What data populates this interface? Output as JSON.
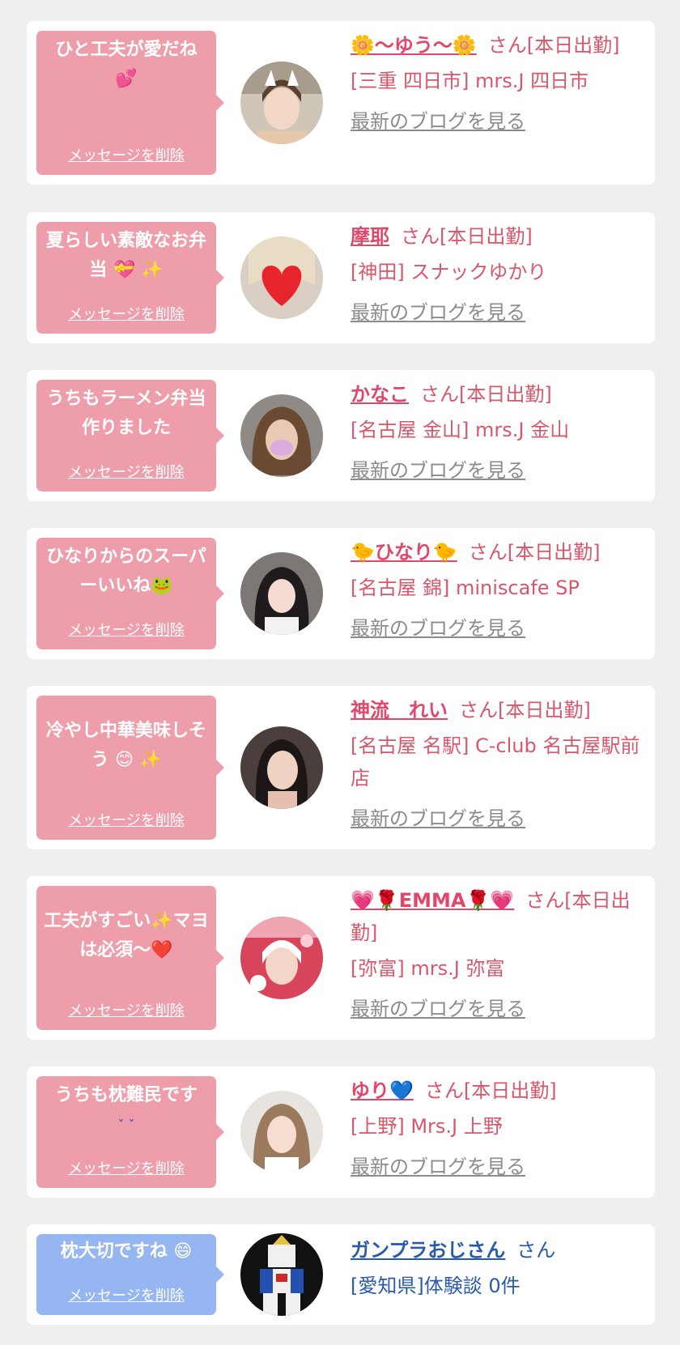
{
  "colors": {
    "bubble_pink": "#ee9eab",
    "bubble_blue": "#95b6f0",
    "name_pink": "#e0486a",
    "text_pink": "#d9576b",
    "text_blue": "#2b5aa8",
    "link_gray": "#8c8c8c",
    "background": "#efefef"
  },
  "delete_label": "メッセージを削除",
  "blog_label": "最新のブログを見る",
  "items": [
    {
      "message": "ひと工夫が愛だね",
      "message_emoji": "💕",
      "name": "🌼〜ゆう〜🌼",
      "suffix": "さん[本日出勤]",
      "shop": "[三重 四日市] mrs.J 四日市"
    },
    {
      "message": "夏らしい素敵なお弁当",
      "message_emoji": "💝 ✨",
      "name": "摩耶",
      "suffix": "さん[本日出勤]",
      "shop": "[神田] スナックゆかり"
    },
    {
      "message": "うちもラーメン弁当作りました",
      "message_emoji": "",
      "name": "かなこ",
      "suffix": "さん[本日出勤]",
      "shop": "[名古屋 金山] mrs.J 金山"
    },
    {
      "message": "ひなりからのスーパーいいね",
      "message_emoji": "🐸",
      "name": "🐤ひなり🐤",
      "suffix": "さん[本日出勤]",
      "shop": "[名古屋 錦] miniscafe SP"
    },
    {
      "message": "冷やし中華美味しそう",
      "message_emoji": "😊 ✨",
      "name": "神流　れい",
      "suffix": "さん[本日出勤]",
      "shop": "[名古屋 名駅] C-club 名古屋駅前店"
    },
    {
      "message": "工夫がすごい✨マヨは必須〜",
      "message_emoji": "❤️",
      "name": "💗🌹EMMA🌹💗",
      "suffix": "さん[本日出勤]",
      "shop": "[弥富] mrs.J 弥富"
    },
    {
      "message": "うちも枕難民です",
      "message_emoji": "ˇ ˇ",
      "name": "ゆり💙",
      "suffix": "さん[本日出勤]",
      "shop": "[上野] Mrs.J 上野"
    },
    {
      "message": "枕大切ですね",
      "message_emoji": "😄",
      "name": "ガンプラおじさん",
      "suffix": "さん",
      "shop": "[愛知県]体験談 0件"
    }
  ]
}
